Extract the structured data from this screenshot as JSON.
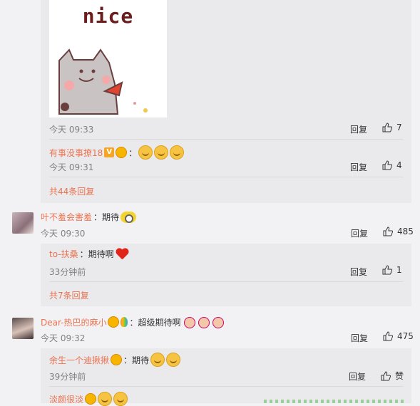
{
  "sticker": {
    "text": "nice"
  },
  "thread1": {
    "time": "今天 09:33",
    "reply_label": "回复",
    "likes": "7",
    "reply1": {
      "user": "有事没事撩18",
      "vip_letter": "V",
      "colon": "：",
      "time": "今天 09:31",
      "reply_label": "回复",
      "likes": "4"
    },
    "more": "共44条回复"
  },
  "comment2": {
    "user": "叶不羞会害羞",
    "text": "：期待",
    "time": "今天 09:30",
    "reply_label": "回复",
    "likes": "485",
    "reply1": {
      "user": "to-扶桑",
      "text": "：期待啊",
      "time": "33分钟前",
      "reply_label": "回复",
      "likes": "1"
    },
    "more": "共7条回复"
  },
  "comment3": {
    "user": "Dear-热巴的麻小",
    "text": "：超级期待啊",
    "time": "今天 09:32",
    "reply_label": "回复",
    "likes": "475",
    "reply1": {
      "user": "余生一个迪揪揪",
      "text": "：期待",
      "time": "39分钟前",
      "reply_label": "回复",
      "likes": "赞"
    },
    "reply2": {
      "user": "淡颜很淡"
    }
  }
}
